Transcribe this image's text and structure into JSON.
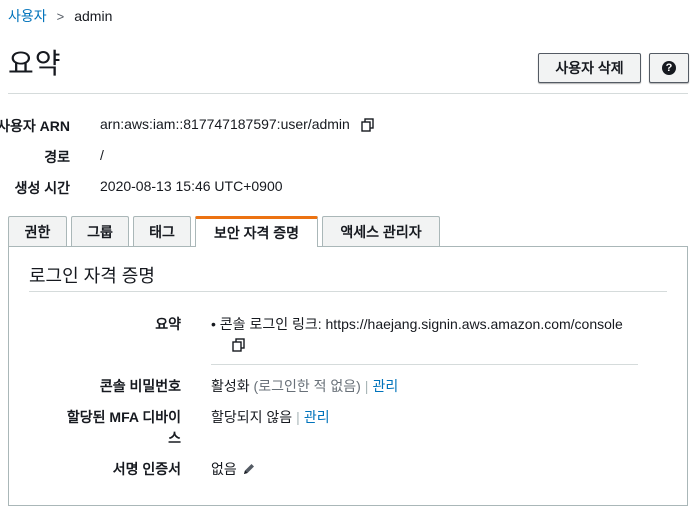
{
  "breadcrumb": {
    "parent": "사용자",
    "separator": ">",
    "current": "admin"
  },
  "page_title": "요약",
  "buttons": {
    "delete_user": "사용자 삭제",
    "help": "?"
  },
  "summary": {
    "arn_label": "사용자 ARN",
    "arn_value": "arn:aws:iam::817747187597:user/admin",
    "path_label": "경로",
    "path_value": "/",
    "created_label": "생성 시간",
    "created_value": "2020-08-13 15:46 UTC+0900"
  },
  "tabs": [
    "권한",
    "그룹",
    "태그",
    "보안 자격 증명",
    "액세스 관리자"
  ],
  "active_tab": "보안 자격 증명",
  "signin_section": {
    "title": "로그인 자격 증명",
    "summary_label": "요약",
    "console_link_label": "콘솔 로그인 링크: ",
    "console_link_url": "https://haejang.signin.aws.amazon.com/console",
    "password_label": "콘솔 비밀번호",
    "password_status": "활성화",
    "password_note": "(로그인한 적 없음)",
    "pipe": "|",
    "manage": "관리",
    "mfa_label_line1": "할당된 MFA 디바이",
    "mfa_label_line2": "스",
    "mfa_status": "할당되지 않음",
    "cert_label": "서명 인증서",
    "cert_value": "없음"
  },
  "colors": {
    "link": "#0073bb",
    "active_tab_accent": "#ec7211",
    "border": "#aab7b8"
  }
}
